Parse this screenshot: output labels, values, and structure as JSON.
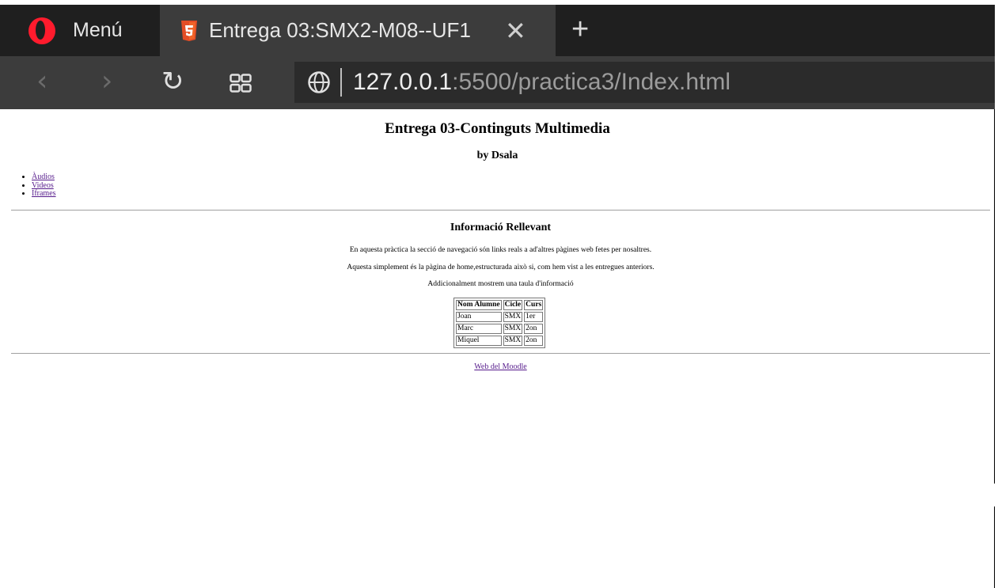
{
  "browser": {
    "menu_label": "Menú",
    "tab_title": "Entrega 03:SMX2-M08--UF1",
    "close_glyph": "✕",
    "new_tab_glyph": "+",
    "url_host": "127.0.0.1",
    "url_rest": ":5500/practica3/Index.html",
    "icons": {
      "menu": "opera-logo-icon",
      "tab": "html5-icon",
      "back": "chevron-left-icon",
      "forward": "chevron-right-icon",
      "reload": "reload-icon",
      "speed_dial": "grid-icon",
      "site_info": "globe-icon"
    },
    "colors": {
      "tabbar": "#1f1f1f",
      "toolbar": "#3c3c3c",
      "opera_red": "#ff1b2d",
      "html5_orange": "#e44d26"
    }
  },
  "page": {
    "title": "Entrega 03-Continguts Multimedia",
    "subtitle": "by Dsala",
    "nav": [
      "Àudios",
      "Videos",
      "Iframes"
    ],
    "section_title": "Informació Rellevant",
    "paragraphs": [
      "En aquesta pràctica la secció de navegació són links reals a ad'altres pàgines web fetes per nosaltres.",
      "Aquesta simplement és la pàgina de home,estructurada això si, com hem vist a les entregues anteriors.",
      "Addicionalment mostrem una taula d'informació"
    ],
    "table": {
      "headers": [
        "Nom Alumne",
        "Cicle",
        "Curs"
      ],
      "rows": [
        [
          "Joan",
          "SMX",
          "1er"
        ],
        [
          "Marc",
          "SMX",
          "2on"
        ],
        [
          "Miquel",
          "SMX",
          "2on"
        ]
      ]
    },
    "footer_link": "Web del Moodle",
    "link_color": "#551a8b"
  }
}
